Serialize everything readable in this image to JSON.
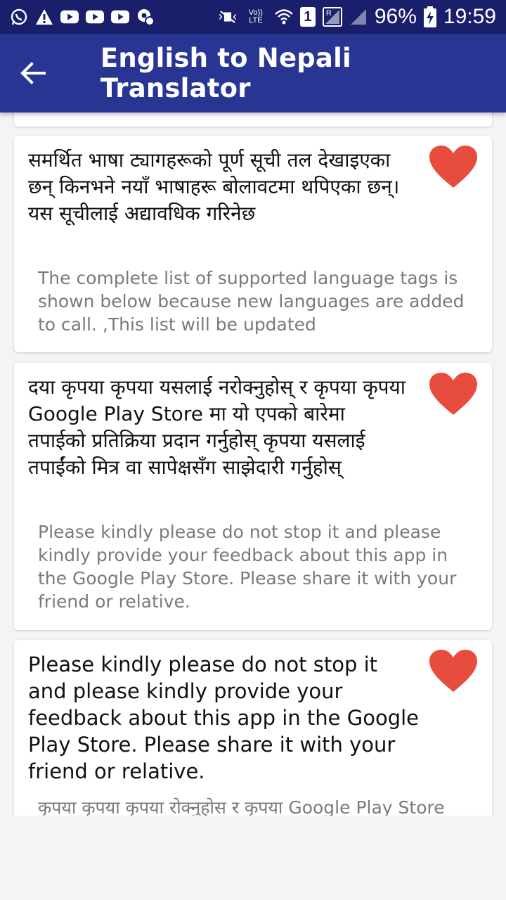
{
  "status_bar": {
    "notification_icons": [
      "whatsapp-icon",
      "warning-icon",
      "youtube-icon",
      "youtube-icon",
      "youtube-icon",
      "settings-notification-icon"
    ],
    "volte_label": "Vo)) LTE",
    "sim_number": "1",
    "sim_label": "R",
    "battery": "96%",
    "time": "19:59"
  },
  "app_bar": {
    "title": "English to Nepali Translator"
  },
  "cards": [
    {
      "primary": "समर्थित भाषा ट्यागहरूको पूर्ण सूची तल देखाइएका छन् किनभने नयाँ भाषाहरू बोलावटमा थपिएका छन्। यस सूचीलाई अद्यावधिक गरिनेछ",
      "secondary": "The complete list of supported language tags is shown below because new languages are added to call.  ,This list will be updated",
      "favorite_icon": "heart-icon"
    },
    {
      "primary": "दया कृपया कृपया यसलाई नरोक्नुहोस् र कृपया कृपया Google Play Store मा यो एपको बारेमा तपाईको प्रतिक्रिया प्रदान गर्नुहोस् कृपया यसलाई तपाईंको मित्र वा सापेक्षसँग साझेदारी गर्नुहोस्",
      "secondary": "Please kindly please do not stop it and please kindly provide your feedback about this app in the Google Play Store. Please share it with your friend or relative.",
      "favorite_icon": "heart-icon"
    },
    {
      "primary": "Please kindly please do not stop it and please kindly provide your feedback about this app in the Google Play Store. Please share it with your friend or relative.",
      "secondary": "कृपया कृपया कृपया रोक्नुहोस र कृपया Google Play Store",
      "favorite_icon": "heart-icon"
    }
  ],
  "colors": {
    "status_bar": "#1a1f6b",
    "app_bar": "#283593",
    "heart": "#e84c3d",
    "background": "#f4f4f4"
  }
}
